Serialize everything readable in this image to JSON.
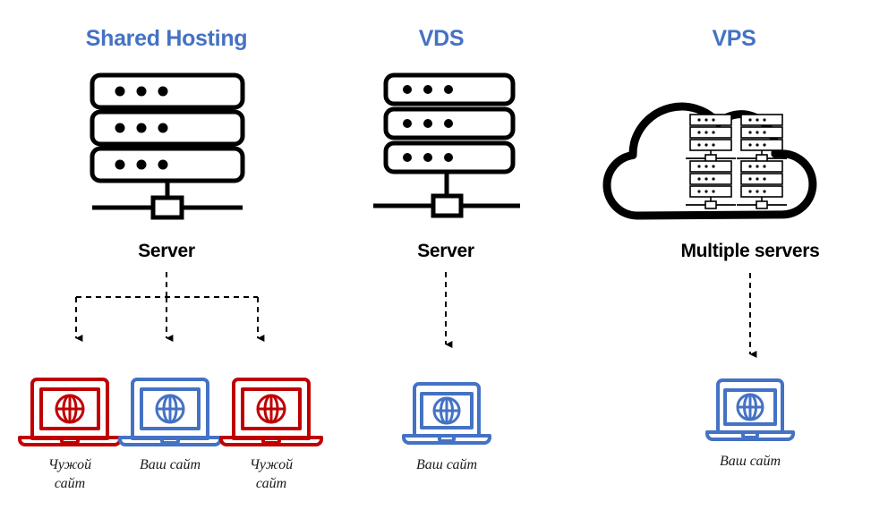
{
  "diagram": {
    "title_shared": "Shared Hosting",
    "title_vds": "VDS",
    "title_vps": "VPS",
    "label_server_shared": "Server",
    "label_server_vds": "Server",
    "label_multiple_servers": "Multiple servers",
    "site_foreign_line1": "Чужой",
    "site_foreign_line2": "сайт",
    "site_yours": "Ваш сайт",
    "site_yours_vds": "Ваш сайт",
    "site_yours_vps": "Ваш сайт",
    "site_foreign_right_line1": "Чужой",
    "site_foreign_right_line2": "сайт"
  },
  "colors": {
    "title_blue": "#4472C4",
    "laptop_blue": "#4472C4",
    "laptop_red": "#C00000",
    "stroke_black": "#000000",
    "background": "#FFFFFF"
  },
  "icons": {
    "server_rack": "server-rack-icon",
    "cloud": "cloud-icon",
    "laptop_globe": "laptop-globe-icon",
    "arrow": "dashed-arrow-icon"
  },
  "columns": [
    {
      "id": "shared-hosting",
      "title": "Shared Hosting",
      "node_type": "server-rack",
      "node_label": "Server",
      "sites": [
        {
          "label_lines": [
            "Чужой",
            "сайт"
          ],
          "color": "#C00000",
          "owner": "foreign"
        },
        {
          "label_lines": [
            "Ваш сайт"
          ],
          "color": "#4472C4",
          "owner": "yours"
        },
        {
          "label_lines": [
            "Чужой",
            "сайт"
          ],
          "color": "#C00000",
          "owner": "foreign"
        }
      ]
    },
    {
      "id": "vds",
      "title": "VDS",
      "node_type": "server-rack",
      "node_label": "Server",
      "sites": [
        {
          "label_lines": [
            "Ваш сайт"
          ],
          "color": "#4472C4",
          "owner": "yours"
        }
      ]
    },
    {
      "id": "vps",
      "title": "VPS",
      "node_type": "cloud",
      "node_label": "Multiple servers",
      "server_count": 4,
      "sites": [
        {
          "label_lines": [
            "Ваш сайт"
          ],
          "color": "#4472C4",
          "owner": "yours"
        }
      ]
    }
  ]
}
